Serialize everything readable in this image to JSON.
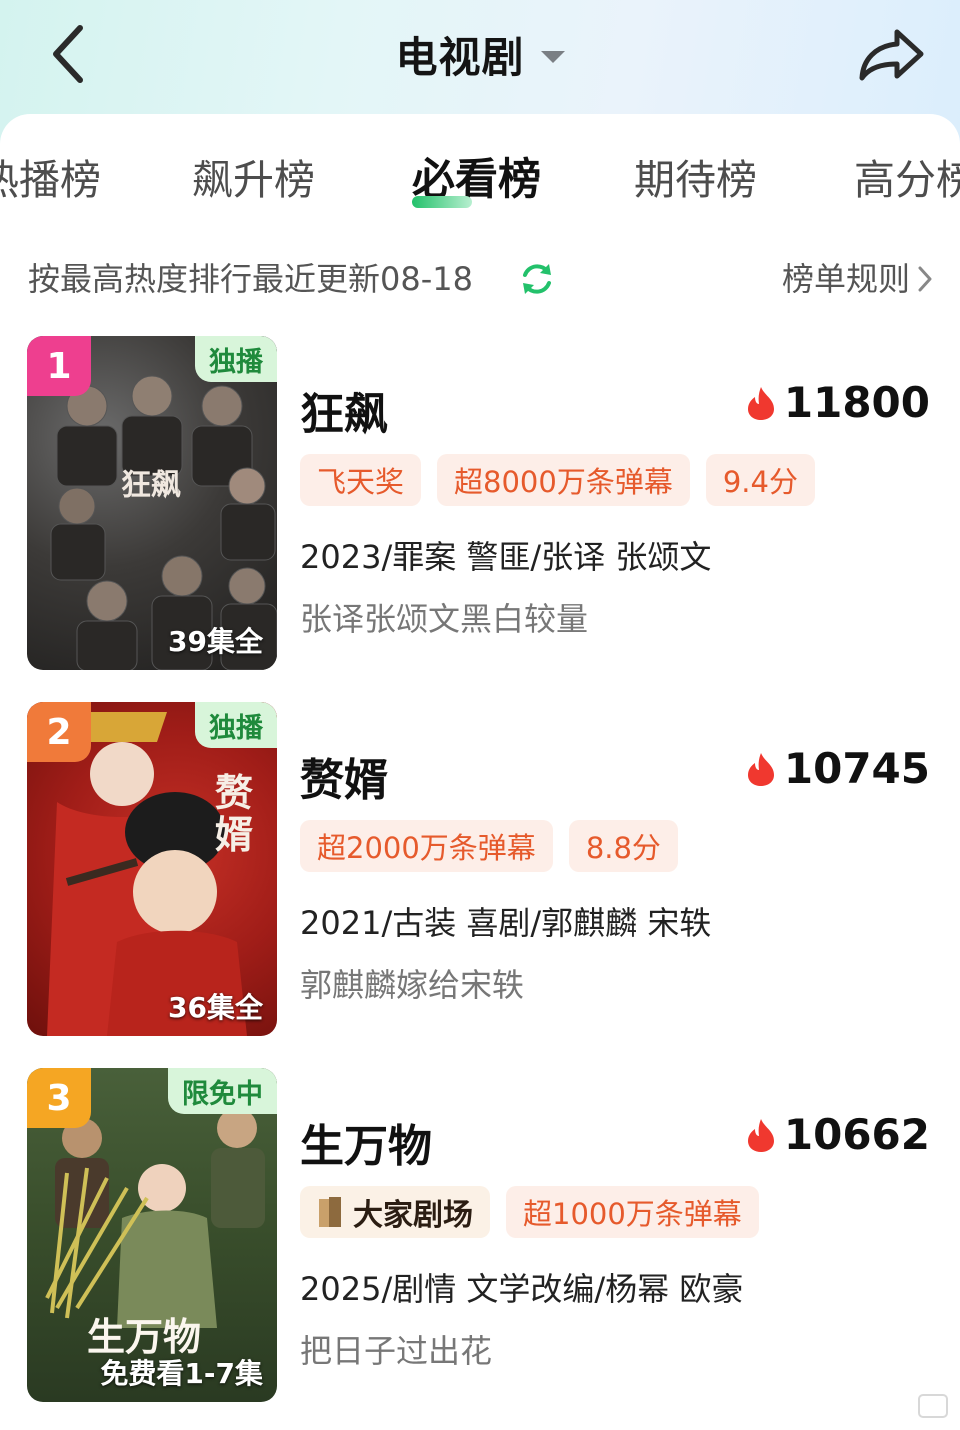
{
  "header": {
    "title": "电视剧",
    "back_icon": "chevron-left-icon",
    "share_icon": "share-arrow-icon"
  },
  "tabs": [
    {
      "label": "热播榜"
    },
    {
      "label": "飙升榜"
    },
    {
      "label": "必看榜",
      "active": true
    },
    {
      "label": "期待榜"
    },
    {
      "label": "高分榜"
    }
  ],
  "subbar": {
    "sort_text": "按最高热度排行最近更新08-18",
    "rules_link": "榜单规则"
  },
  "colors": {
    "accent_green": "#23c16b",
    "tag_orange": "#e65a2c",
    "rank1": "#ee3f8f",
    "rank2": "#f07a3a",
    "rank3": "#f5a623"
  },
  "items": [
    {
      "rank": "1",
      "badge": "独播",
      "poster_text": "狂飙",
      "episodes": "39集全",
      "title": "狂飙",
      "heat": "11800",
      "tags": [
        "飞天奖",
        "超8000万条弹幕",
        "9.4分"
      ],
      "meta": "2023/罪案 警匪/张译 张颂文",
      "desc": "张译张颂文黑白较量"
    },
    {
      "rank": "2",
      "badge": "独播",
      "poster_text": "赘婿",
      "episodes": "36集全",
      "title": "赘婿",
      "heat": "10745",
      "tags": [
        "超2000万条弹幕",
        "8.8分"
      ],
      "meta": "2021/古装 喜剧/郭麒麟 宋轶",
      "desc": "郭麒麟嫁给宋轶"
    },
    {
      "rank": "3",
      "badge": "限免中",
      "poster_text": "生万物",
      "episodes": "免费看1-7集",
      "title": "生万物",
      "heat": "10662",
      "brand_tag": "大家剧场",
      "tags": [
        "超1000万条弹幕"
      ],
      "meta": "2025/剧情 文学改编/杨幂 欧豪",
      "desc": "把日子过出花"
    }
  ]
}
